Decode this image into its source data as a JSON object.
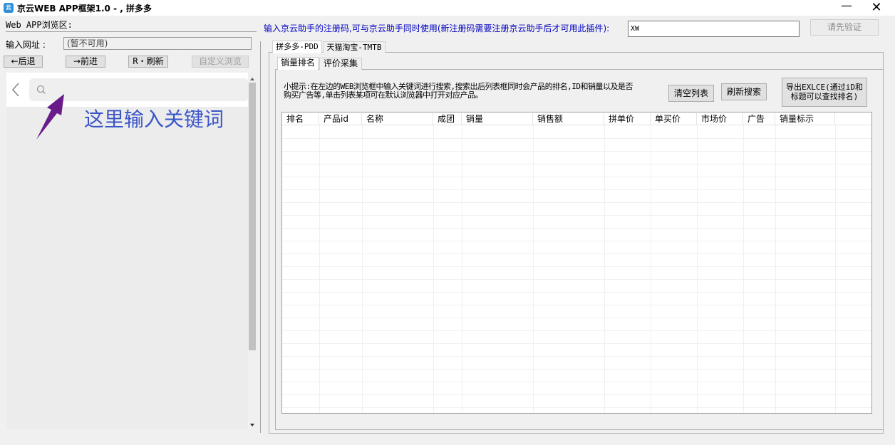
{
  "window": {
    "title": "京云WEB APP框架1.0 - , 拼多多",
    "minimize_glyph": "—",
    "close_glyph": "✕",
    "icon": "app-icon"
  },
  "left_panel": {
    "section_label": "Web APP浏览区:",
    "url_label": "输入网址 :",
    "url_value": "(暂不可用)",
    "back_label": "←后退",
    "forward_label": "→前进",
    "refresh_label": "R・刷新",
    "custom_browse_label": "自定义浏览",
    "hint_text": "这里输入关键词",
    "hint_color": "#3a55c8",
    "arrow_color": "#6a1b8a"
  },
  "right_panel": {
    "reg_label": "输入京云助手的注册码,可与京云助手同时使用(新注册码需要注册京云助手后才可用此插件):",
    "reg_value": "XW",
    "verify_label": "请先验证",
    "tabs": [
      {
        "label": "拼多多-PDD"
      },
      {
        "label": "天猫淘宝-TMTB"
      }
    ],
    "subtabs": [
      {
        "label": "销量排名"
      },
      {
        "label": "评价采集"
      }
    ],
    "tip_text": "小提示:在左边的WEB浏览框中输入关键词进行搜索,搜索出后列表框同时会产品的排名,ID和销量以及是否购买广告等,单击列表某项可在默认浏览器中打开对应产品。",
    "clear_label": "清空列表",
    "research_label": "刷新搜索",
    "export_label": "导出EXLCE(通过iD和标题可以查找排名)",
    "columns": [
      "排名",
      "产品id",
      "名称",
      "成团",
      "销量",
      "销售额",
      "拼单价",
      "单买价",
      "市场价",
      "广告",
      "销量标示"
    ],
    "accent_color": "#0000c0"
  }
}
